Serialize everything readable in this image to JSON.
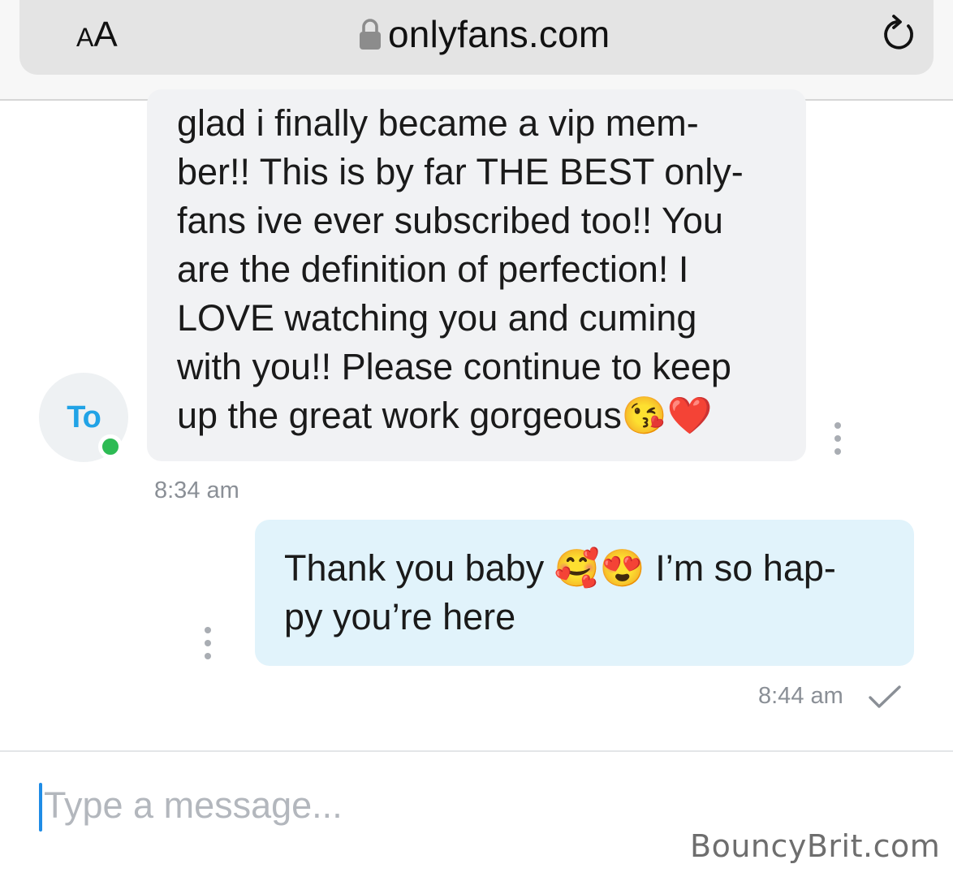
{
  "browser": {
    "text_size_small": "A",
    "text_size_large": "A",
    "url": "onlyfans.com",
    "lock_icon": "lock-icon",
    "reload_icon": "reload-icon"
  },
  "conversation": {
    "contact": {
      "initials": "To",
      "status": "online"
    },
    "messages": [
      {
        "direction": "incoming",
        "text": "glad i finally became a vip mem-\nber!! This is by far THE BEST only-\nfans ive ever subscribed too!! You\nare the definition of perfection! I\nLOVE watching you and cuming\nwith you!! Please continue to keep\nup the great work gorgeous😘❤️",
        "time": "8:34 am"
      },
      {
        "direction": "outgoing",
        "text": "Thank you baby 🥰😍 I’m so hap-\npy you’re here",
        "time": "8:44 am",
        "read": true
      }
    ]
  },
  "composer": {
    "placeholder": "Type a message..."
  },
  "watermark": "BouncyBrit.com",
  "colors": {
    "accent": "#21a3e6",
    "online": "#2dbb54",
    "incoming_bubble": "#f1f2f4",
    "outgoing_bubble": "#e1f3fb"
  }
}
